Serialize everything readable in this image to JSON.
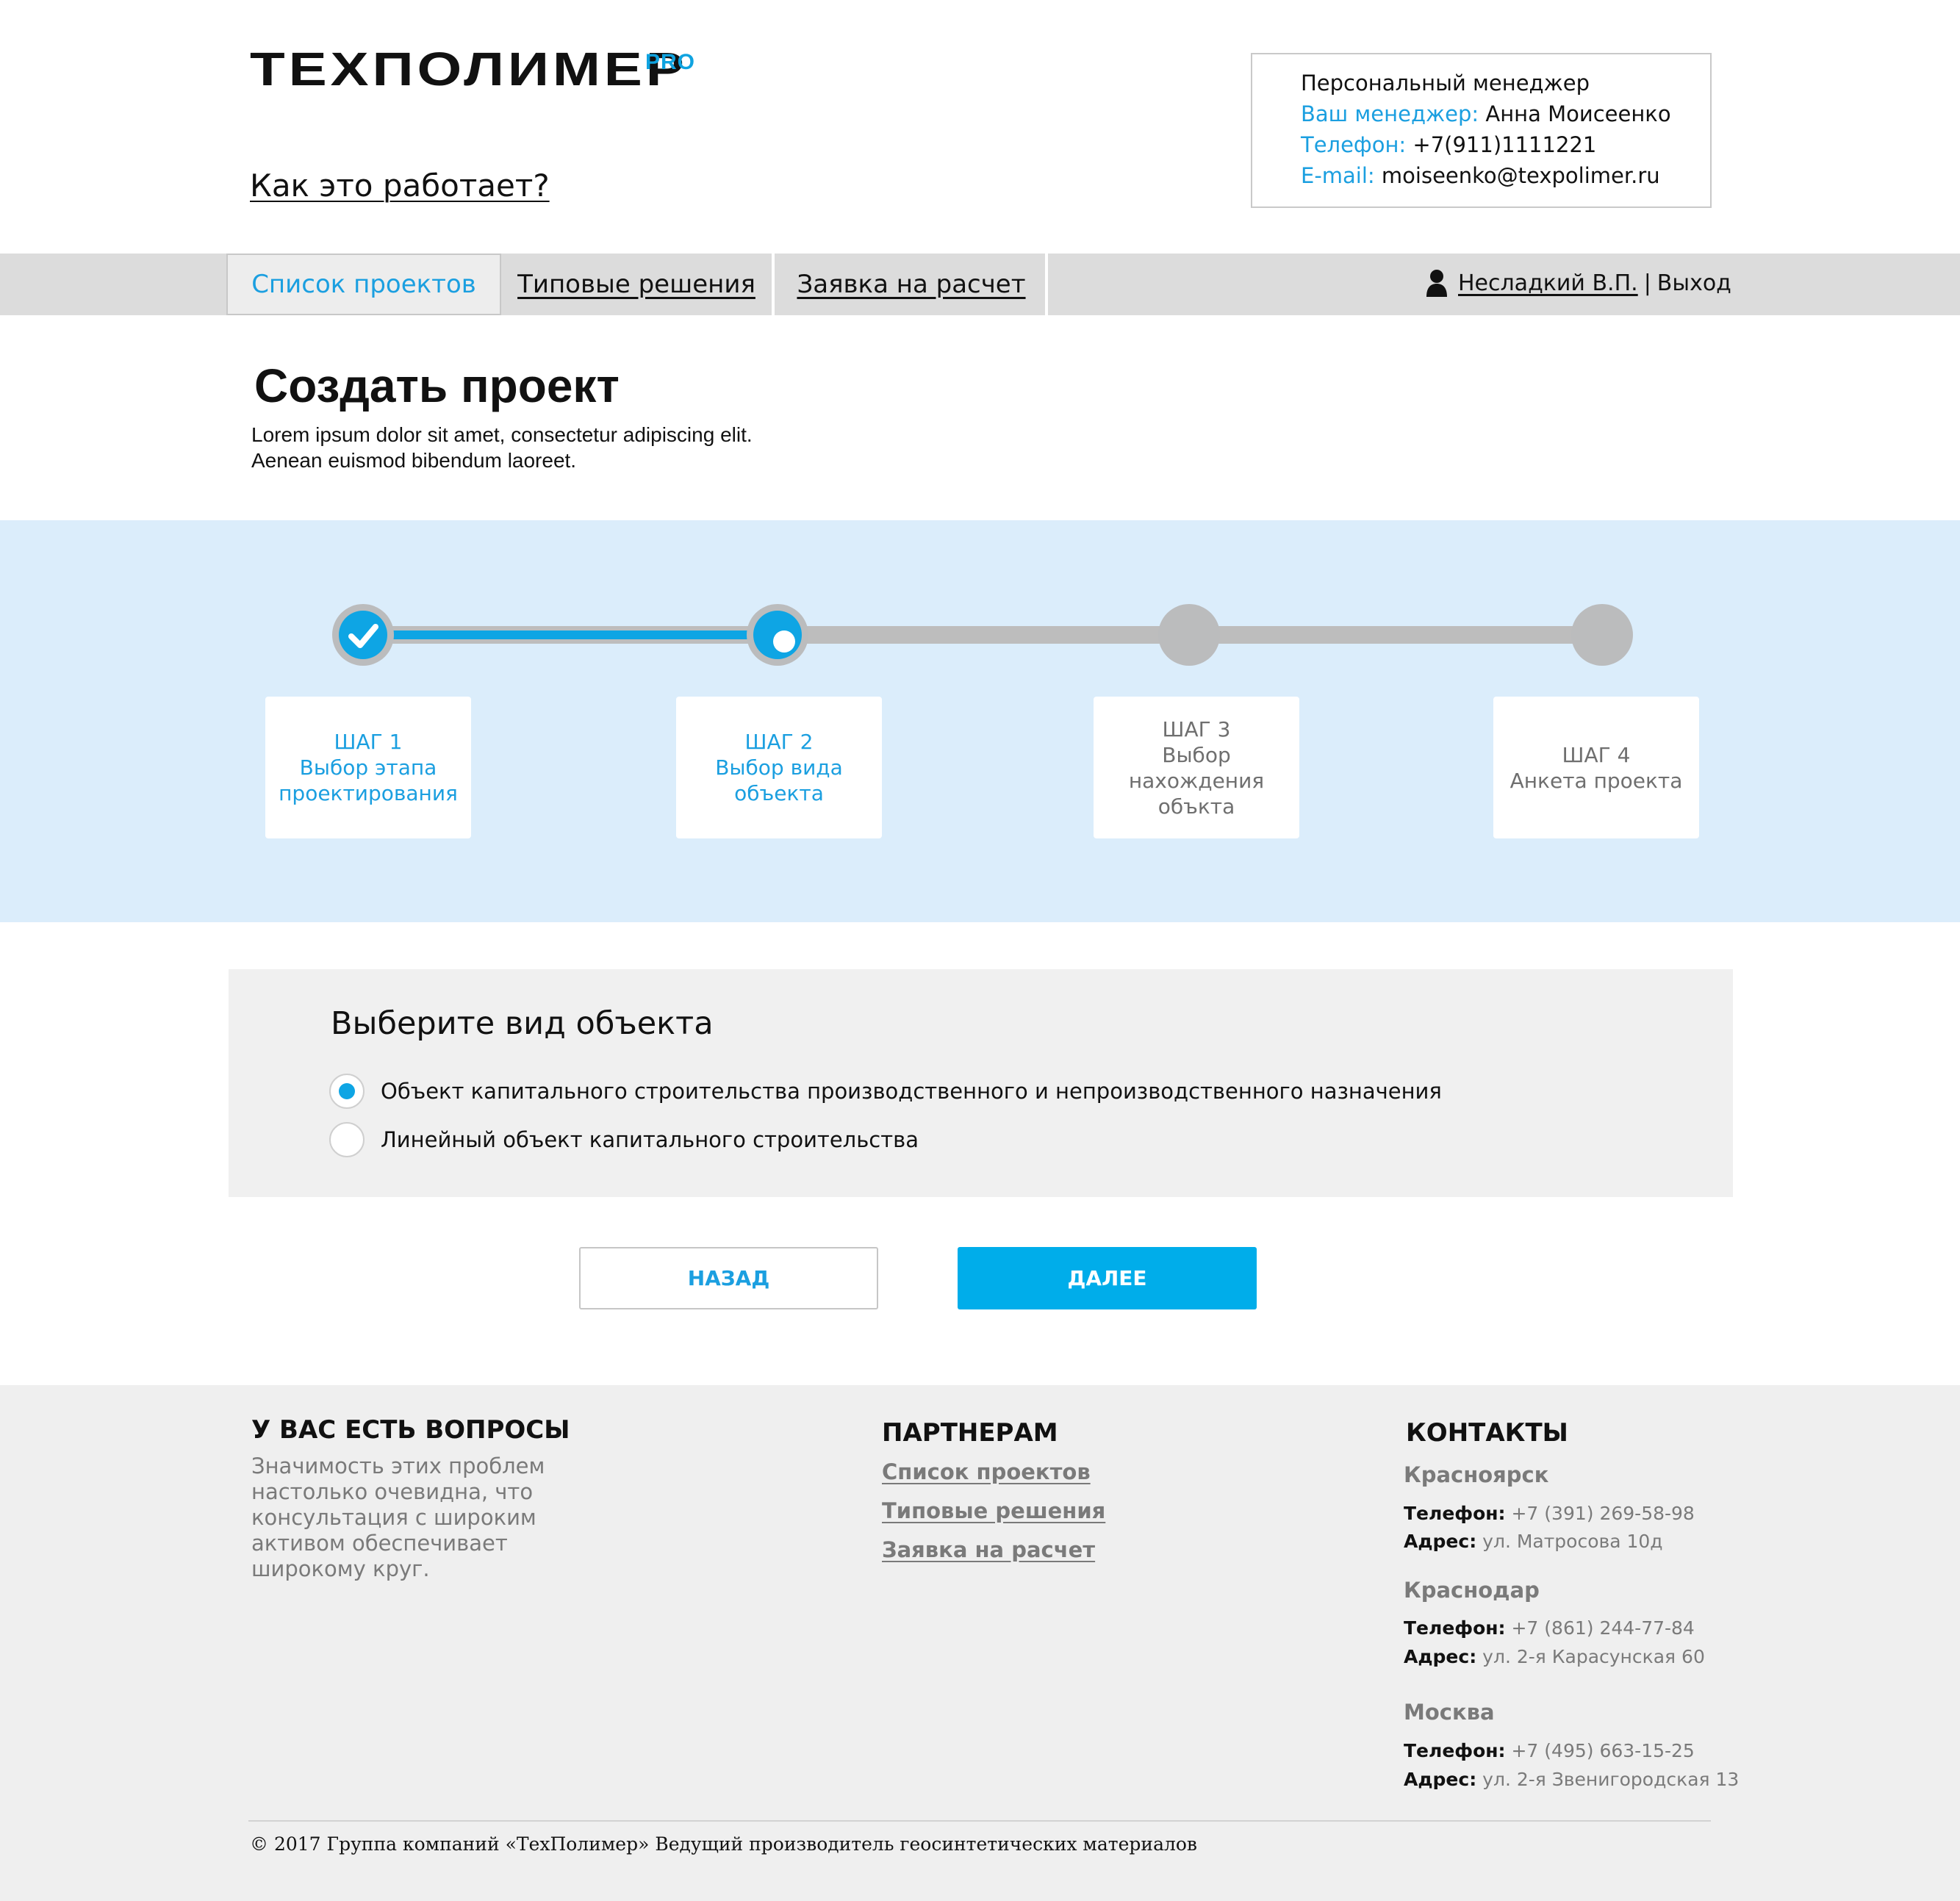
{
  "header": {
    "logo_text": "ТЕХПОЛИМЕР",
    "logo_suffix": "PRO",
    "how_it_works": "Как это работает?"
  },
  "manager": {
    "title": "Персональный менеджер",
    "manager_label": "Ваш менеджер:",
    "manager_value": "Анна Моисеенко",
    "phone_label": "Телефон:",
    "phone_value": "+7(911)1111221",
    "email_label": "E-mail:",
    "email_value": "moiseenko@texpolimer.ru"
  },
  "nav": {
    "tabs": [
      {
        "label": "Список проектов",
        "active": true
      },
      {
        "label": "Типовые решения",
        "active": false
      },
      {
        "label": "Заявка на расчет",
        "active": false
      }
    ],
    "user_name": "Несладкий В.П.",
    "separator": "|",
    "logout": "Выход"
  },
  "page": {
    "title": "Создать проект",
    "desc_line1": "Lorem ipsum dolor sit amet, consectetur adipiscing elit.",
    "desc_line2": "Aenean euismod bibendum laoreet."
  },
  "stepper": {
    "current_step": 2,
    "steps": [
      {
        "num": "ШАГ 1",
        "line1": "Выбор этапа",
        "line2": "проектирования",
        "line3": "",
        "state": "done"
      },
      {
        "num": "ШАГ 2",
        "line1": "Выбор вида",
        "line2": "объекта",
        "line3": "",
        "state": "active"
      },
      {
        "num": "ШАГ 3",
        "line1": "Выбор",
        "line2": "нахождения",
        "line3": "объкта",
        "state": "pending"
      },
      {
        "num": "ШАГ 4",
        "line1": "Анкета проекта",
        "line2": "",
        "line3": "",
        "state": "pending"
      }
    ]
  },
  "form": {
    "title": "Выберите вид объекта",
    "options": [
      {
        "label": "Объект капитального строительства производственного и непроизводственного назначения",
        "checked": true
      },
      {
        "label": "Линейный объект капитального строительства",
        "checked": false
      }
    ],
    "back_label": "НАЗАД",
    "next_label": "ДАЛЕЕ"
  },
  "footer": {
    "questions_title": "У ВАС ЕСТЬ ВОПРОСЫ",
    "questions_lines": [
      "Значимость этих проблем",
      "настолько очевидна, что",
      "консультация с широким",
      "активом обеспечивает",
      "широкому круг."
    ],
    "partners_title": "ПАРТНЕРАМ",
    "partners_links": [
      "Список проектов",
      "Типовые решения",
      "Заявка на расчет"
    ],
    "contacts_title": "КОНТАКТЫ",
    "phone_label": "Телефон:",
    "address_label": "Адрес:",
    "cities": [
      {
        "name": "Красноярск",
        "phone": "+7 (391) 269-58-98",
        "address": "ул. Матросова 10д"
      },
      {
        "name": "Краснодар",
        "phone": "+7 (861) 244-77-84",
        "address": "ул. 2-я Карасунская 60"
      },
      {
        "name": "Москва",
        "phone": "+7 (495) 663-15-25",
        "address": "ул. 2-я Звенигородская 13"
      }
    ],
    "copyright": "© 2017 Группа компаний «ТехПолимер» Ведущий производитель геосинтетических материалов"
  },
  "colors": {
    "accent": "#0ea5e4",
    "link_blue": "#1b9fe0",
    "stepper_bg": "#dbedfb",
    "panel_bg": "#f0f0f0",
    "footer_bg": "#efefef"
  }
}
